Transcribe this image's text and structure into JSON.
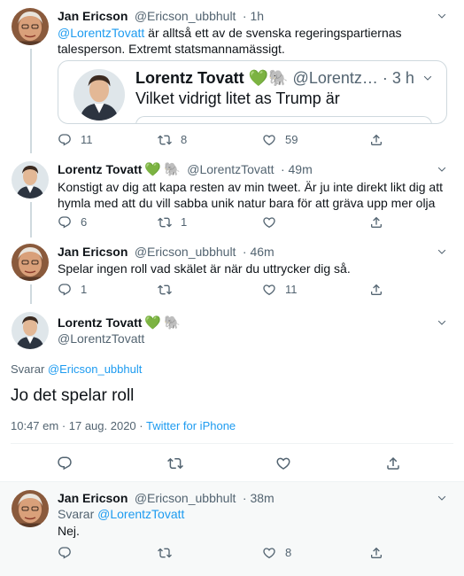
{
  "tweets": [
    {
      "name": "Jan Ericson",
      "handle": "@Ericson_ubbhult",
      "time": "· 1h",
      "mention": "@LorentzTovatt",
      "text": " är alltså ett av de svenska regeringspartiernas talesperson. Extremt statsmannamässigt.",
      "quote": {
        "name": "Lorentz Tovatt",
        "heart": "💚",
        "elephant": "🐘",
        "handle": "@Lorentz…",
        "time": "· 3 h",
        "text": "Vilket vidrigt litet as Trump är"
      },
      "replies": "11",
      "retweets": "8",
      "likes": "59"
    },
    {
      "name": "Lorentz Tovatt",
      "heart": "💚",
      "elephant": "🐘",
      "handle": "@LorentzTovatt",
      "time": "· 49m",
      "text": "Konstigt av dig att kapa resten av min tweet. Är ju inte direkt likt dig att hymla med att du vill sabba unik natur bara för att gräva upp mer olja",
      "replies": "6",
      "retweets": "1",
      "likes": ""
    },
    {
      "name": "Jan Ericson",
      "handle": "@Ericson_ubbhult",
      "time": "· 46m",
      "text": "Spelar ingen roll vad skälet är när du uttrycker dig så.",
      "replies": "1",
      "retweets": "",
      "likes": "11"
    }
  ],
  "focus": {
    "name": "Lorentz Tovatt",
    "heart": "💚",
    "elephant": "🐘",
    "handle": "@LorentzTovatt",
    "reply_prefix": "Svarar",
    "reply_to": "@Ericson_ubbhult",
    "text": "Jo det spelar roll",
    "timestamp": "10:47 em · 17 aug. 2020",
    "separator": " · ",
    "client": "Twitter for iPhone"
  },
  "last_reply": {
    "name": "Jan Ericson",
    "handle": "@Ericson_ubbhult",
    "time": "· 38m",
    "reply_prefix": "Svarar",
    "reply_to": "@LorentzTovatt",
    "text": "Nej.",
    "replies": "",
    "retweets": "",
    "likes": "8"
  },
  "colors": {
    "accent": "#1d9bf0",
    "secondary_text": "#536471",
    "reply_background": "#f7f9f9"
  }
}
